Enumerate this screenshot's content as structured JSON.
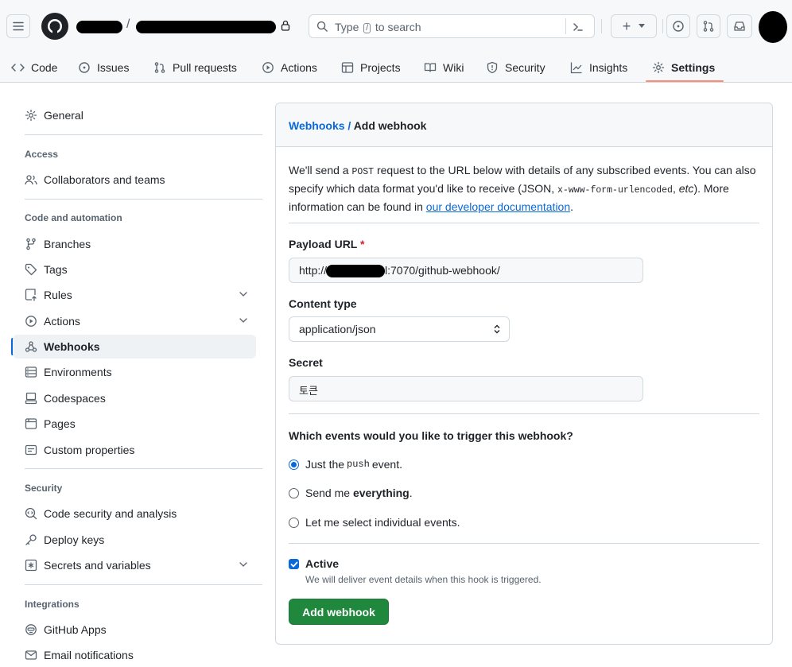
{
  "header": {
    "separator": "/",
    "search_placeholder_pre": "Type",
    "search_key": "/",
    "search_placeholder_post": "to search",
    "create_label": "+"
  },
  "repo_nav": {
    "tabs": [
      {
        "label": "Code",
        "icon": "code-icon"
      },
      {
        "label": "Issues",
        "icon": "issue-opened-icon"
      },
      {
        "label": "Pull requests",
        "icon": "git-pull-request-icon"
      },
      {
        "label": "Actions",
        "icon": "play-icon"
      },
      {
        "label": "Projects",
        "icon": "table-icon"
      },
      {
        "label": "Wiki",
        "icon": "book-icon"
      },
      {
        "label": "Security",
        "icon": "shield-icon"
      },
      {
        "label": "Insights",
        "icon": "graph-icon"
      },
      {
        "label": "Settings",
        "icon": "gear-icon",
        "selected": true
      }
    ]
  },
  "sidebar": {
    "general": "General",
    "sections": {
      "access": "Access",
      "code_automation": "Code and automation",
      "security": "Security",
      "integrations": "Integrations"
    },
    "items": {
      "collaborators": "Collaborators and teams",
      "branches": "Branches",
      "tags": "Tags",
      "rules": "Rules",
      "actions": "Actions",
      "webhooks": "Webhooks",
      "environments": "Environments",
      "codespaces": "Codespaces",
      "pages": "Pages",
      "custom_properties": "Custom properties",
      "code_security": "Code security and analysis",
      "deploy_keys": "Deploy keys",
      "secrets": "Secrets and variables",
      "github_apps": "GitHub Apps",
      "email_notifications": "Email notifications"
    },
    "active_item": "Webhooks"
  },
  "main": {
    "breadcrumb_link": "Webhooks",
    "breadcrumb_sep": " / ",
    "breadcrumb_current": "Add webhook",
    "intro": {
      "p1": "We'll send a ",
      "post": "POST",
      "p2": " request to the URL below with details of any subscribed events. You can also specify which data format you'd like to receive (JSON, ",
      "urlenc": "x-www-form-urlencoded",
      "p3": ", ",
      "etc": "etc",
      "p4": "). More information can be found in ",
      "link": "our developer documentation",
      "p5": "."
    },
    "payload_label": "Payload URL",
    "required_mark": "*",
    "payload_prefix": "http://3",
    "payload_suffix": "l:7070/github-webhook/",
    "content_type_label": "Content type",
    "content_type_value": "application/json",
    "secret_label": "Secret",
    "secret_value": "토큰",
    "events_question": "Which events would you like to trigger this webhook?",
    "event_options": {
      "push_pre": "Just the ",
      "push_code": "push",
      "push_post": " event.",
      "everything_pre": "Send me ",
      "everything_bold": "everything",
      "everything_post": ".",
      "individual": "Let me select individual events."
    },
    "selected_event": "push",
    "active_label": "Active",
    "active_checked": true,
    "active_note": "We will deliver event details when this hook is triggered.",
    "submit_label": "Add webhook"
  },
  "colors": {
    "accent": "#0969da",
    "primary_button": "#1f883d",
    "tab_underline": "#fd8c73",
    "required": "#d1242f"
  }
}
